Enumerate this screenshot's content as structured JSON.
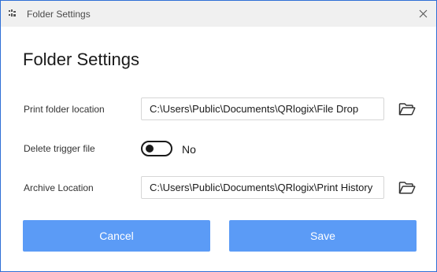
{
  "window": {
    "title": "Folder Settings",
    "app_icon": "app-icon",
    "close_icon": "close-icon"
  },
  "heading": "Folder Settings",
  "print_folder": {
    "label": "Print folder location",
    "value": "C:\\Users\\Public\\Documents\\QRlogix\\File Drop",
    "browse_icon": "folder-open-icon"
  },
  "delete_trigger": {
    "label": "Delete trigger file",
    "state_text": "No",
    "enabled": false
  },
  "archive": {
    "label": "Archive Location",
    "value": "C:\\Users\\Public\\Documents\\QRlogix\\Print History",
    "browse_icon": "folder-open-icon"
  },
  "buttons": {
    "cancel": "Cancel",
    "save": "Save"
  },
  "colors": {
    "accent": "#5b9bf6",
    "border": "#2f6fd6",
    "titlebar": "#f0f0f0"
  }
}
